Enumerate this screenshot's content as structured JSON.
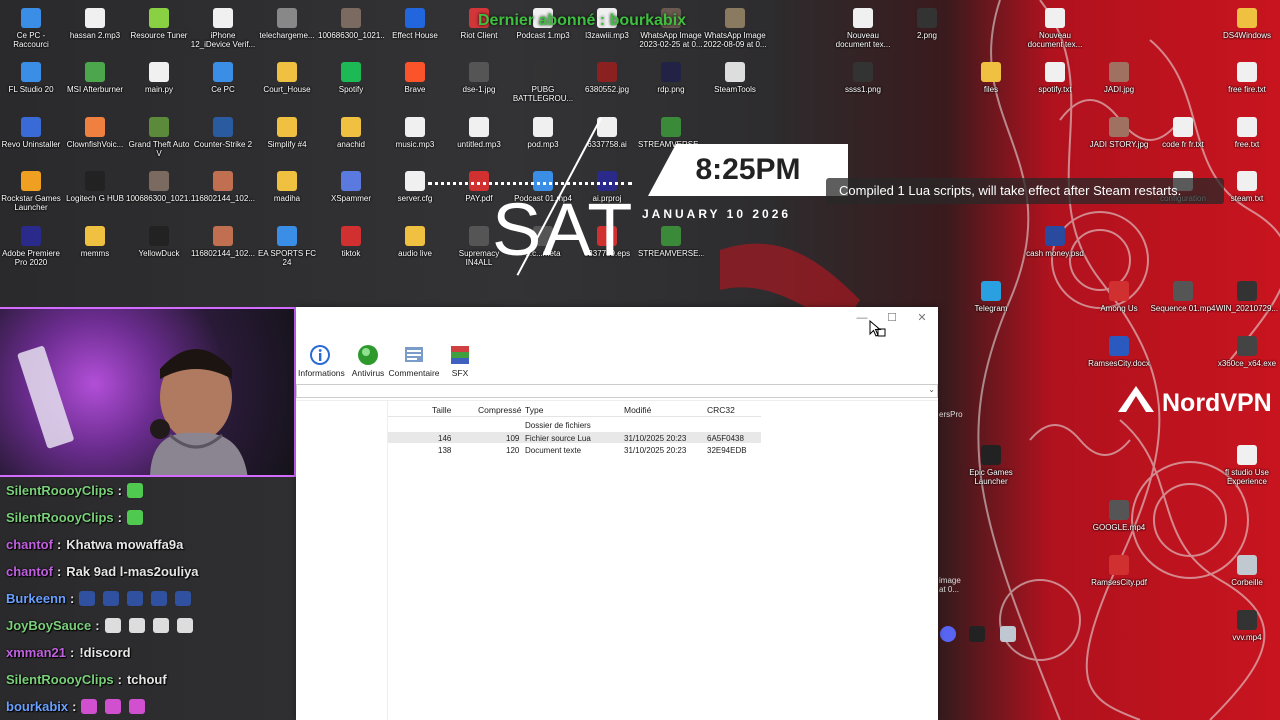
{
  "desktop": {
    "icons": [
      {
        "label": "Ce PC - Raccourci",
        "color": "#3a8ee6"
      },
      {
        "label": "hassan 2.mp3",
        "color": "#f0f0f0"
      },
      {
        "label": "Resource Tuner",
        "color": "#8ad043"
      },
      {
        "label": "iPhone 12_iDevice Verif...",
        "color": "#f0f0f0"
      },
      {
        "label": "telechargeme...",
        "color": "#888888"
      },
      {
        "label": "100686300_1021...",
        "color": "#7a6a60"
      },
      {
        "label": "Effect House",
        "color": "#2266dd"
      },
      {
        "label": "Riot Client",
        "color": "#d13639"
      },
      {
        "label": "Podcast 1.mp3",
        "color": "#f0f0f0"
      },
      {
        "label": "l3zawiii.mp3",
        "color": "#f0f0f0"
      },
      {
        "label": "WhatsApp Image 2023-02-25 at 0...",
        "color": "#6a5a50"
      },
      {
        "label": "WhatsApp Image 2022-08-09 at 0...",
        "color": "#8a7a60"
      },
      {
        "label": "Nouveau document tex...",
        "color": "#f0f0f0"
      },
      {
        "label": "2.png",
        "color": "#333333"
      },
      {
        "label": "Nouveau document tex...",
        "color": "#f0f0f0"
      },
      {
        "label": "DS4Windows",
        "color": "#f0c040"
      },
      {
        "label": "FL Studio 20",
        "color": "#3a8ee6"
      },
      {
        "label": "MSI Afterburner",
        "color": "#4ca64c"
      },
      {
        "label": "main.py",
        "color": "#f0f0f0"
      },
      {
        "label": "Ce PC",
        "color": "#3a8ee6"
      },
      {
        "label": "Court_House",
        "color": "#f0c040"
      },
      {
        "label": "Spotify",
        "color": "#1db954"
      },
      {
        "label": "Brave",
        "color": "#fb542b"
      },
      {
        "label": "dse-1.jpg",
        "color": "#555555"
      },
      {
        "label": "PUBG BATTLEGROU...",
        "color": "#333333"
      },
      {
        "label": "6380552.jpg",
        "color": "#8a2020"
      },
      {
        "label": "rdp.png",
        "color": "#222244"
      },
      {
        "label": "SteamTools",
        "color": "#dddddd"
      },
      {
        "label": "ssss1.png",
        "color": "#333333"
      },
      {
        "label": "files",
        "color": "#f0c040"
      },
      {
        "label": "spotify.txt",
        "color": "#f0f0f0"
      },
      {
        "label": "JADI.jpg",
        "color": "#a07060"
      },
      {
        "label": "free fire.txt",
        "color": "#f0f0f0"
      },
      {
        "label": "Revo Uninstaller",
        "color": "#3a6ad6"
      },
      {
        "label": "ClownfishVoic...",
        "color": "#f08040"
      },
      {
        "label": "Grand Theft Auto V",
        "color": "#5a8a3a"
      },
      {
        "label": "Counter-Strike 2",
        "color": "#2a5aa0"
      },
      {
        "label": "Simplify #4",
        "color": "#f0c040"
      },
      {
        "label": "anachid",
        "color": "#f0c040"
      },
      {
        "label": "music.mp3",
        "color": "#f0f0f0"
      },
      {
        "label": "untitled.mp3",
        "color": "#f0f0f0"
      },
      {
        "label": "pod.mp3",
        "color": "#f0f0f0"
      },
      {
        "label": "6337758.ai",
        "color": "#f0f0f0"
      },
      {
        "label": "STREAMVERSE...",
        "color": "#3a8a3a"
      },
      {
        "label": "JADI STORY.jpg",
        "color": "#a07060"
      },
      {
        "label": "code fr fr.txt",
        "color": "#f0f0f0"
      },
      {
        "label": "free.txt",
        "color": "#f0f0f0"
      },
      {
        "label": "Rockstar Games Launcher",
        "color": "#f0a020"
      },
      {
        "label": "Logitech G HUB",
        "color": "#222222"
      },
      {
        "label": "100686300_1021...",
        "color": "#7a6a60"
      },
      {
        "label": "116802144_102...",
        "color": "#c07050"
      },
      {
        "label": "madiha",
        "color": "#f0c040"
      },
      {
        "label": "XSpammer",
        "color": "#5a7ae0"
      },
      {
        "label": "server.cfg",
        "color": "#f0f0f0"
      },
      {
        "label": "PAY.pdf",
        "color": "#d03030"
      },
      {
        "label": "Podcast 01.mp4",
        "color": "#3a8ee6"
      },
      {
        "label": "ai.prproj",
        "color": "#2a2a8a"
      },
      {
        "label": "configuration",
        "color": "#f0f0f0"
      },
      {
        "label": "steam.txt",
        "color": "#f0f0f0"
      },
      {
        "label": "Adobe Premiere Pro 2020",
        "color": "#2a2a8a"
      },
      {
        "label": "memms",
        "color": "#f0c040"
      },
      {
        "label": "YellowDuck",
        "color": "#222222"
      },
      {
        "label": "116802144_102...",
        "color": "#c07050"
      },
      {
        "label": "EA SPORTS FC 24",
        "color": "#3a8ee6"
      },
      {
        "label": "tiktok",
        "color": "#d03030"
      },
      {
        "label": "audio live",
        "color": "#f0c040"
      },
      {
        "label": "Supremacy IN4ALL",
        "color": "#555555"
      },
      {
        "label": "...c...meta",
        "color": "#555555"
      },
      {
        "label": "6337759.eps",
        "color": "#d03030"
      },
      {
        "label": "STREAMVERSE...",
        "color": "#3a8a3a"
      },
      {
        "label": "cash money.psd",
        "color": "#2a4aa0"
      },
      {
        "label": "Among Us",
        "color": "#d03030"
      },
      {
        "label": "Sequence 01.mp4",
        "color": "#555555"
      },
      {
        "label": "WIN_20210729...",
        "color": "#333333"
      },
      {
        "label": "Telegram",
        "color": "#2aa0e0"
      },
      {
        "label": "RamsesCity.docx",
        "color": "#2a5ac0"
      },
      {
        "label": "x360ce_x64.exe",
        "color": "#444444"
      },
      {
        "label": "Epic Games Launcher",
        "color": "#222222"
      },
      {
        "label": "fl studio Use Experience",
        "color": "#f0f0f0"
      },
      {
        "label": "GOOGLE.mp4",
        "color": "#555555"
      },
      {
        "label": "RamsesCity.pdf",
        "color": "#d03030"
      },
      {
        "label": "Corbeille",
        "color": "#c0c8d0"
      },
      {
        "label": "vvv.mp4",
        "color": "#333333"
      }
    ]
  },
  "clock": {
    "time": "8:25PM",
    "day": "SAT",
    "date": "JANUARY 10 2026"
  },
  "overlay": {
    "last_subscriber": "Dernier abonné : bourkabix"
  },
  "toast": {
    "message": "Compiled 1 Lua scripts, will take effect after Steam restarts."
  },
  "nordvpn": {
    "label": "NordVPN"
  },
  "chat": {
    "messages": [
      {
        "user": "SilentRoooyClips",
        "sep": ":",
        "text": "",
        "user_color": "#7ad07a",
        "emotes": [
          "#4fc94f"
        ]
      },
      {
        "user": "SilentRoooyClips",
        "sep": ":",
        "text": "",
        "user_color": "#7ad07a",
        "emotes": [
          "#4fc94f"
        ]
      },
      {
        "user": "chantof",
        "sep": ":",
        "text": "Khatwa mowaffa9a",
        "user_color": "#c060e0",
        "emotes": []
      },
      {
        "user": "chantof",
        "sep": ":",
        "text": "Rak 9ad l-mas2ouliya",
        "user_color": "#c060e0",
        "emotes": []
      },
      {
        "user": "Burkeenn",
        "sep": ":",
        "text": "",
        "user_color": "#6aa0ff",
        "emotes": [
          "#3050a0",
          "#3050a0",
          "#3050a0",
          "#3050a0",
          "#3050a0"
        ]
      },
      {
        "user": "JoyBoySauce",
        "sep": ":",
        "text": "",
        "user_color": "#7ad07a",
        "emotes": [
          "#dddddd",
          "#dddddd",
          "#dddddd",
          "#dddddd"
        ]
      },
      {
        "user": "xmman21",
        "sep": ":",
        "text": "!discord",
        "user_color": "#c060e0",
        "emotes": []
      },
      {
        "user": "SilentRoooyClips",
        "sep": ":",
        "text": "tchouf",
        "user_color": "#7ad07a",
        "emotes": []
      },
      {
        "user": "bourkabix",
        "sep": ":",
        "text": "",
        "user_color": "#6aa0ff",
        "emotes": [
          "#d050d0",
          "#d050d0",
          "#d050d0"
        ]
      }
    ]
  },
  "winrar": {
    "titlebar": {
      "minimize": "—",
      "maximize": "☐",
      "close": "✕"
    },
    "toolbar": [
      {
        "label": "Informations",
        "icon": "info-icon"
      },
      {
        "label": "Antivirus",
        "icon": "antivirus-icon"
      },
      {
        "label": "Commentaire",
        "icon": "comment-icon"
      },
      {
        "label": "SFX",
        "icon": "sfx-icon"
      }
    ],
    "columns": [
      "Taille",
      "Compressé",
      "Type",
      "Modifié",
      "CRC32"
    ],
    "rows": [
      {
        "size": "",
        "packed": "",
        "type": "Dossier de fichiers",
        "modified": "",
        "crc": ""
      },
      {
        "size": "146",
        "packed": "109",
        "type": "Fichier source Lua",
        "modified": "31/10/2025 20:23",
        "crc": "6A5F0438"
      },
      {
        "size": "138",
        "packed": "120",
        "type": "Document texte",
        "modified": "31/10/2025 20:23",
        "crc": "32E94EDB"
      }
    ]
  },
  "side_labels": {
    "ers_pro": "ersPro",
    "image_at": "image at 0..."
  }
}
